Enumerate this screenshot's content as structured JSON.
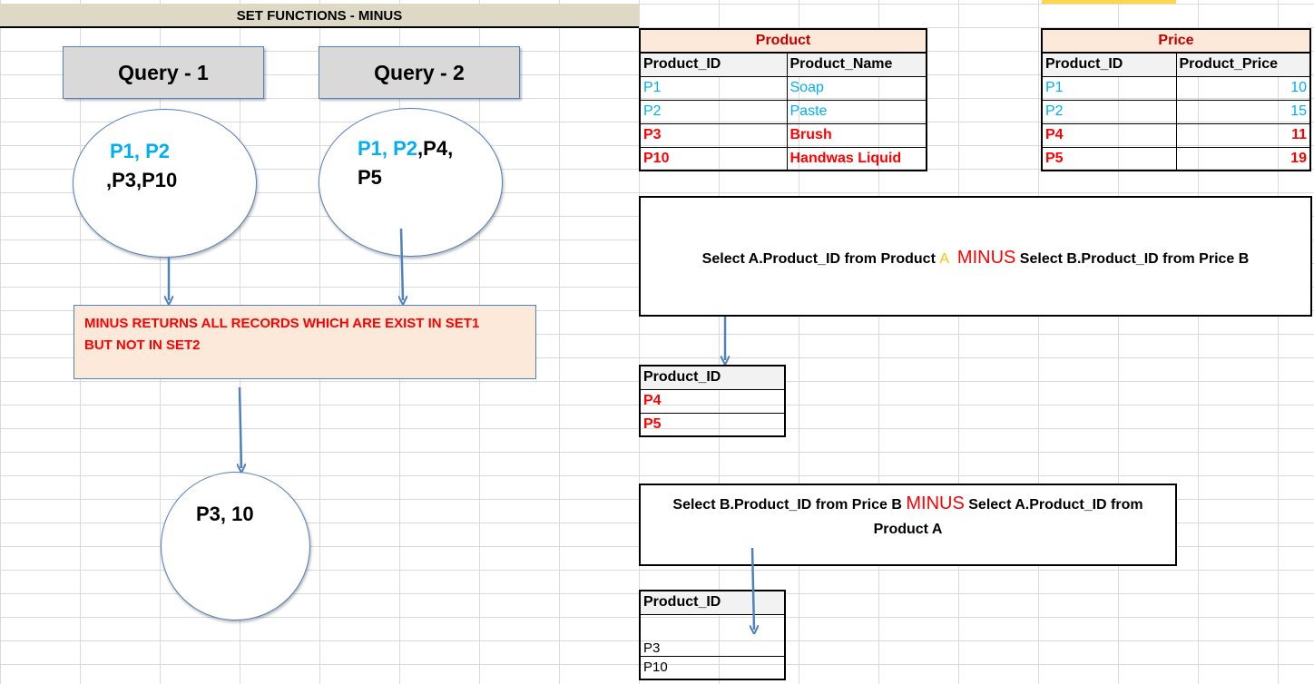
{
  "title": "SET FUNCTIONS - MINUS",
  "queries": {
    "q1_label": "Query - 1",
    "q2_label": "Query - 2"
  },
  "set1": {
    "cyan": "P1, P2",
    "black": ",P3,P10"
  },
  "set2": {
    "cyan": "P1, P2",
    "black_a": ",P4,",
    "black_b": "P5"
  },
  "explanation": {
    "line1": "MINUS RETURNS ALL RECORDS WHICH ARE EXIST IN SET1",
    "line2": "BUT NOT IN SET2"
  },
  "result_set": "P3, 10",
  "product_table": {
    "title": "Product",
    "headers": [
      "Product_ID",
      "Product_Name"
    ],
    "rows": [
      [
        "P1",
        "Soap"
      ],
      [
        "P2",
        "Paste"
      ],
      [
        "P3",
        "Brush"
      ],
      [
        "P10",
        "Handwas Liquid"
      ]
    ]
  },
  "price_table": {
    "title": "Price",
    "headers": [
      "Product_ID",
      "Product_Price"
    ],
    "rows": [
      [
        "P1",
        "10"
      ],
      [
        "P2",
        "15"
      ],
      [
        "P4",
        "11"
      ],
      [
        "P5",
        "19"
      ]
    ]
  },
  "query1": {
    "part1": "Select A.Product_ID from Product ",
    "alias": "A",
    "keyword": "MINUS",
    "part2": " Select B.Product_ID from Price B"
  },
  "result1": {
    "header": "Product_ID",
    "rows": [
      "P4",
      "P5"
    ]
  },
  "query2": {
    "part1": "Select B.Product_ID from Price B ",
    "keyword": "MINUS",
    "part2": " Select A.Product_ID from",
    "line2": "Product A"
  },
  "result2": {
    "header": "Product_ID",
    "rows": [
      "P3",
      "P10"
    ]
  },
  "colors": {
    "cyan": "#00b0f0",
    "red": "#ff0000",
    "dark_red": "#c00000",
    "peach": "#fde9d9",
    "arrow": "#4f81bd",
    "title_bar": "#ddd9c4"
  }
}
